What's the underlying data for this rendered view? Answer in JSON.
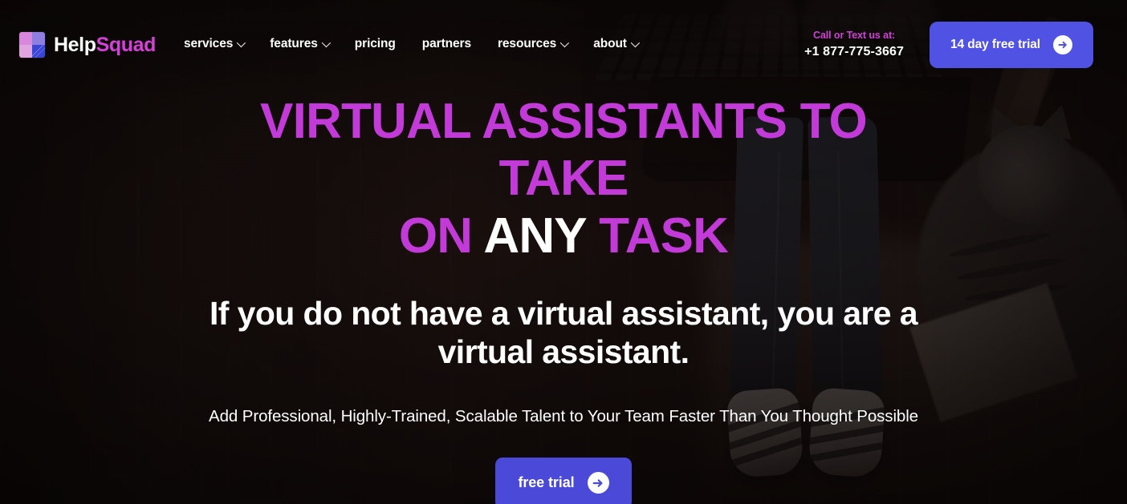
{
  "brand": {
    "name_primary": "Help",
    "name_accent": "Squad",
    "logo_icon": "helpsquad-square-logo-icon"
  },
  "nav": {
    "items": [
      {
        "label": "services",
        "has_dropdown": true,
        "icon": "chevron-down-icon"
      },
      {
        "label": "features",
        "has_dropdown": true,
        "icon": "chevron-down-icon"
      },
      {
        "label": "pricing",
        "has_dropdown": false,
        "icon": ""
      },
      {
        "label": "partners",
        "has_dropdown": false,
        "icon": ""
      },
      {
        "label": "resources",
        "has_dropdown": true,
        "icon": "chevron-down-icon"
      },
      {
        "label": "about",
        "has_dropdown": true,
        "icon": "chevron-down-icon"
      }
    ]
  },
  "contact": {
    "label": "Call or Text us at:",
    "phone": "+1 877-775-3667"
  },
  "header_cta": {
    "label": "14 day free trial",
    "icon": "arrow-right-circle-icon"
  },
  "hero": {
    "headline_line1": "VIRTUAL ASSISTANTS TO TAKE",
    "headline_line2_part1": "ON ",
    "headline_line2_highlight": "ANY",
    "headline_line2_part2": " TASK",
    "subhead": "If you do not have a virtual assistant, you are a virtual assistant.",
    "description": "Add Professional, Highly-Trained, Scalable Talent to Your Team Faster Than You Thought Possible",
    "cta_label": "free trial",
    "cta_icon": "arrow-right-circle-icon"
  },
  "colors": {
    "accent_magenta": "#c23ad7",
    "brand_squad": "#d63fd9",
    "contact_label": "#cf41d6",
    "button_blue": "#4f52e2",
    "cta_blue": "#4a49d8",
    "text_white": "#ffffff",
    "background_dark": "#2a1d1a"
  }
}
